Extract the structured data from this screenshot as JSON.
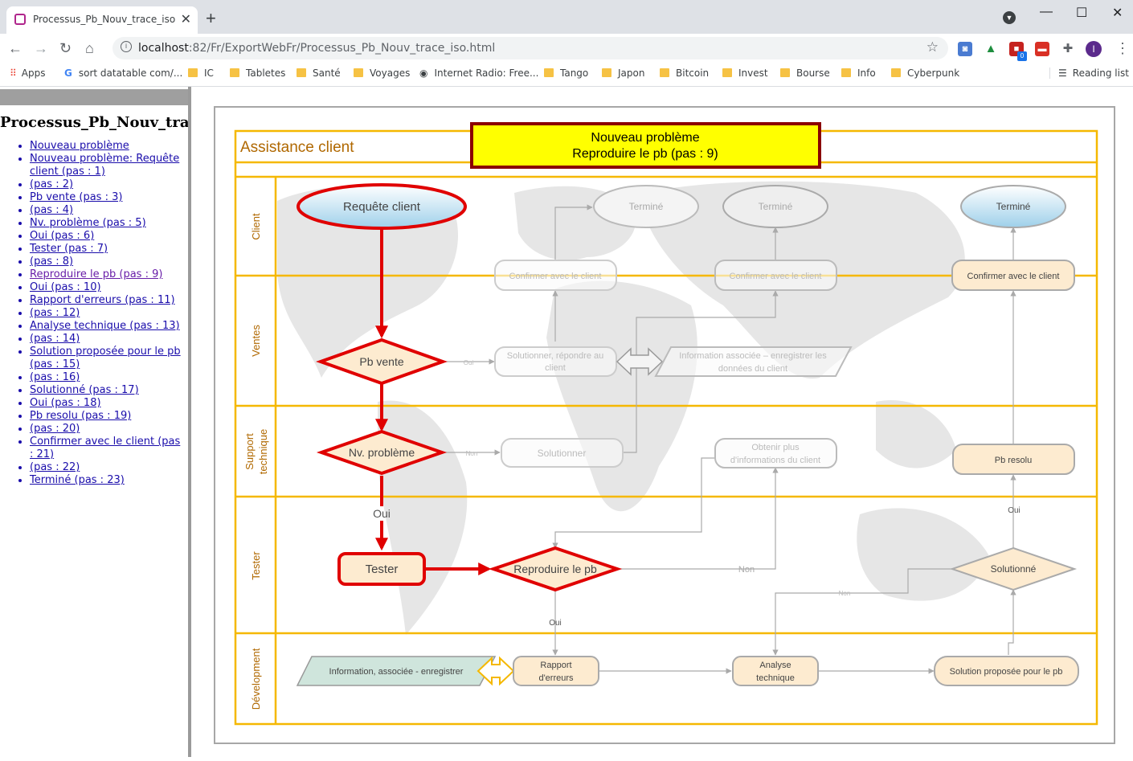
{
  "browser": {
    "tab_title": "Processus_Pb_Nouv_trace_iso",
    "url_host": "localhost",
    "url_rest": ":82/Fr/ExportWebFr/Processus_Pb_Nouv_trace_iso.html",
    "extension_badge": "0",
    "profile_initial": "I",
    "bookmarks": [
      "Apps",
      "sort datatable com/...",
      "IC",
      "Tabletes",
      "Santé",
      "Voyages",
      "Internet Radio: Free...",
      "Tango",
      "Japon",
      "Bitcoin",
      "Invest",
      "Bourse",
      "Info",
      "Cyberpunk"
    ],
    "reading_list": "Reading list"
  },
  "sidebar": {
    "heading": "Processus_Pb_Nouv_trace",
    "steps": [
      {
        "text": "Nouveau problème"
      },
      {
        "text": "Nouveau problème: Requête client (pas : 1)"
      },
      {
        "text": "(pas : 2)"
      },
      {
        "text": "Pb vente (pas : 3)"
      },
      {
        "text": "(pas : 4)"
      },
      {
        "text": "Nv. problème (pas : 5)"
      },
      {
        "text": "Oui (pas : 6)"
      },
      {
        "text": "Tester (pas : 7)"
      },
      {
        "text": "(pas : 8)"
      },
      {
        "text": "Reproduire le pb (pas : 9)",
        "visited": true
      },
      {
        "text": "Oui (pas : 10)"
      },
      {
        "text": "Rapport d'erreurs (pas : 11)"
      },
      {
        "text": "(pas : 12)"
      },
      {
        "text": "Analyse technique (pas : 13)"
      },
      {
        "text": "(pas : 14)"
      },
      {
        "text": "Solution proposée pour le pb (pas : 15)"
      },
      {
        "text": "(pas : 16)"
      },
      {
        "text": "Solutionné (pas : 17)"
      },
      {
        "text": "Oui (pas : 18)"
      },
      {
        "text": "Pb resolu (pas : 19)"
      },
      {
        "text": "(pas : 20)"
      },
      {
        "text": "Confirmer avec le client (pas : 21)"
      },
      {
        "text": "(pas : 22)"
      },
      {
        "text": "Terminé (pas : 23)"
      }
    ]
  },
  "diagram": {
    "header_title": "Assistance client",
    "callout_line1": "Nouveau problème",
    "callout_line2": "Reproduire le pb (pas : 9)",
    "lanes": {
      "client": "Client",
      "ventes": "Ventes",
      "support_1": "Support",
      "support_2": "technique",
      "tester": "Tester",
      "developpement": "Dévelopment"
    },
    "shapes": {
      "requete_client": "Requête client",
      "termine_1": "Terminé",
      "termine_2": "Terminé",
      "termine_3": "Terminé",
      "confirmer_1": "Confirmer avec le client",
      "confirmer_2": "Confirmer avec le client",
      "confirmer_3": "Confirmer avec le client",
      "pb_vente": "Pb vente",
      "solutionner_repondre_1": "Solutionner, répondre au",
      "solutionner_repondre_2": "client",
      "info_enregistrer_1": "Information associée – enregistrer les",
      "info_enregistrer_2": "données du client",
      "nv_probleme": "Nv. problème",
      "solutionner": "Solutionner",
      "obtenir_plus_1": "Obtenir plus",
      "obtenir_plus_2": "d'informations du client",
      "pb_resolu": "Pb resolu",
      "tester": "Tester",
      "reproduire": "Reproduire le pb",
      "solutionne": "Solutionné",
      "info_associee_dev": "Information, associée - enregistrer",
      "rapport_1": "Rapport",
      "rapport_2": "d'erreurs",
      "analyse_1": "Analyse",
      "analyse_2": "technique",
      "solution_proposee": "Solution proposée pour le pb"
    },
    "connector_labels": {
      "oui_main": "Oui",
      "oui_small_1": "Oui",
      "non_small_1": "Non",
      "non_reproduire": "Non",
      "non_small_2": "Non",
      "oui_reproduire": "Oui",
      "oui_resolu": "Oui"
    },
    "colors": {
      "lane_border": "#f5b800",
      "highlight": "#e00000",
      "callout_fill": "#ffff00",
      "callout_border": "#8b0000",
      "shape_fill": "#fdebd0",
      "teal_fill": "#cfe5dc"
    }
  }
}
